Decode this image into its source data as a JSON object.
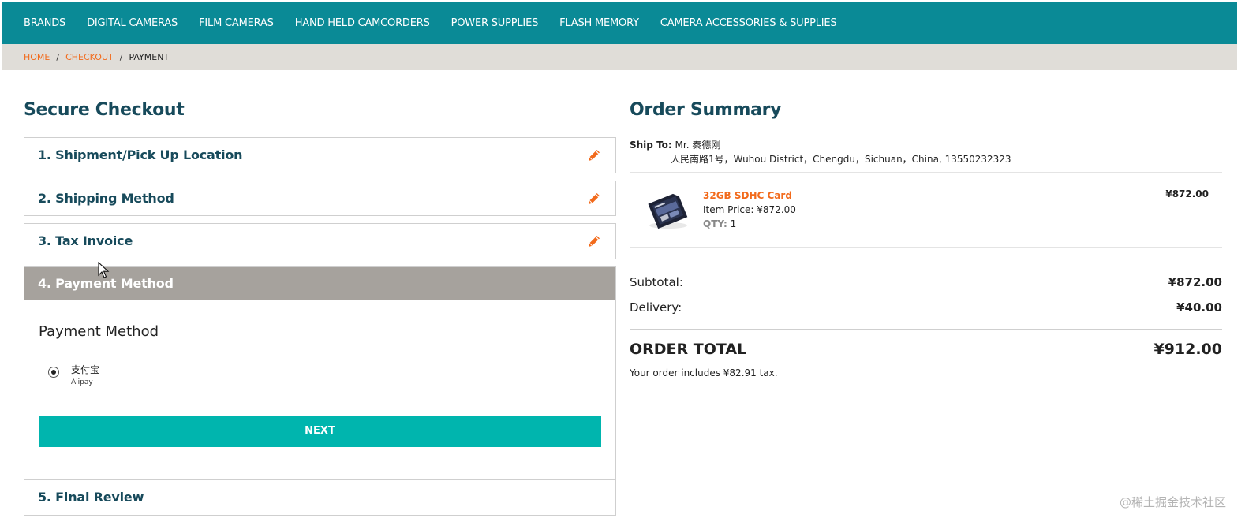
{
  "topnav": {
    "items": [
      "BRANDS",
      "DIGITAL CAMERAS",
      "FILM CAMERAS",
      "HAND HELD CAMCORDERS",
      "POWER SUPPLIES",
      "FLASH MEMORY",
      "CAMERA ACCESSORIES & SUPPLIES"
    ]
  },
  "breadcrumb": {
    "home": "HOME",
    "checkout": "CHECKOUT",
    "current": "PAYMENT",
    "separator": "/"
  },
  "checkout": {
    "title": "Secure Checkout",
    "steps": [
      {
        "label": "1. Shipment/Pick Up Location"
      },
      {
        "label": "2. Shipping Method"
      },
      {
        "label": "3. Tax Invoice"
      },
      {
        "label": "4. Payment Method"
      },
      {
        "label": "5. Final Review"
      }
    ],
    "payment": {
      "heading": "Payment Method",
      "option_main": "支付宝",
      "option_sub": "Alipay",
      "next_label": "NEXT"
    }
  },
  "summary": {
    "title": "Order Summary",
    "ship_to_label": "Ship To:",
    "ship_to_name": "Mr. 秦德刚",
    "ship_to_address": "人民南路1号，Wuhou District，Chengdu，Sichuan，China, 13550232323",
    "item": {
      "name": "32GB SDHC Card",
      "item_price_label": "Item Price:",
      "item_price": "¥872.00",
      "qty_label": "QTY:",
      "qty": "1",
      "line_total": "¥872.00"
    },
    "subtotal_label": "Subtotal:",
    "subtotal": "¥872.00",
    "delivery_label": "Delivery:",
    "delivery": "¥40.00",
    "order_total_label": "ORDER TOTAL",
    "order_total": "¥912.00",
    "tax_note": "Your order includes ¥82.91 tax."
  },
  "watermark": "@稀土掘金技术社区",
  "colors": {
    "nav_bg": "#0a8a96",
    "accent_orange": "#f26a1b",
    "next_button": "#00b5ae",
    "active_step": "#a6a29d",
    "heading": "#174a5b"
  }
}
